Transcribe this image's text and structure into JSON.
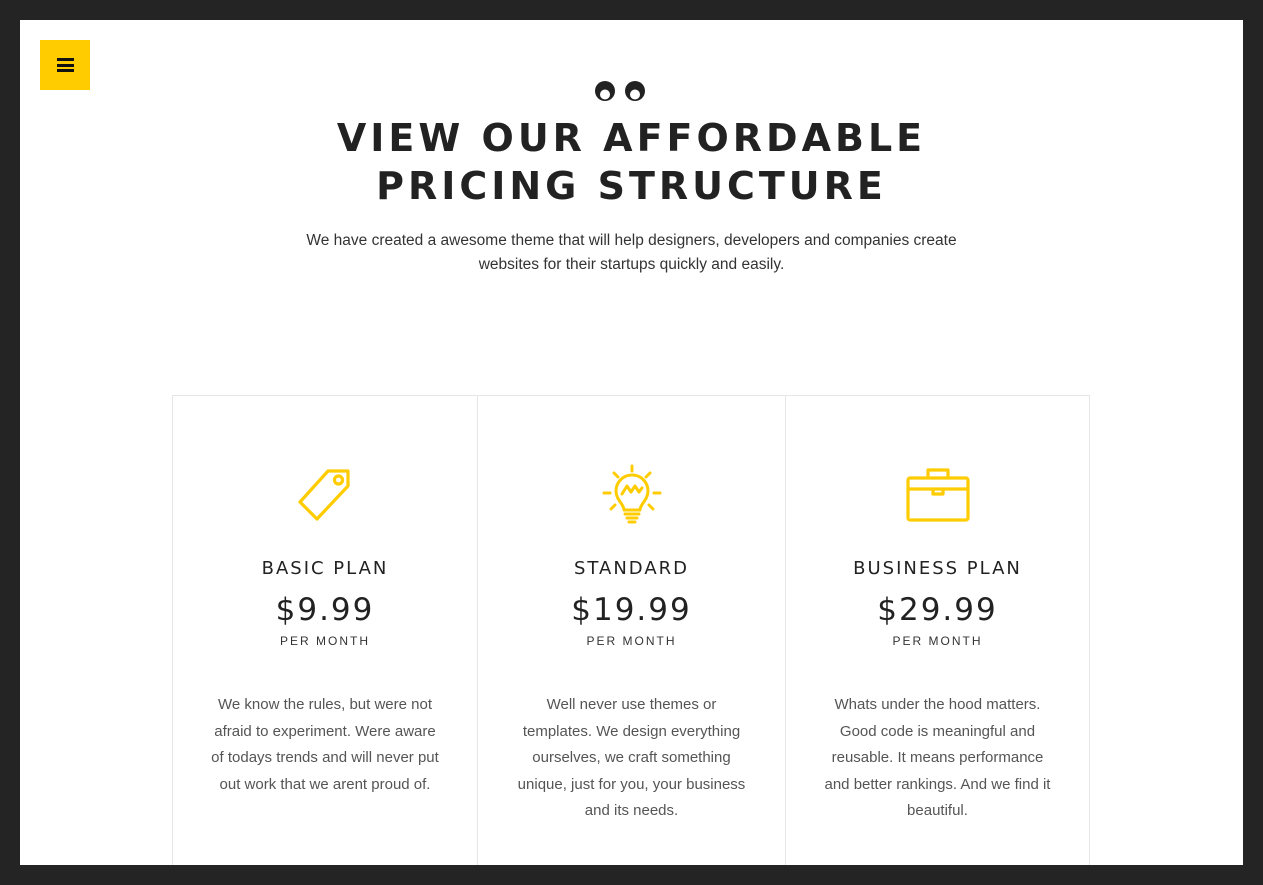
{
  "header": {
    "menu_icon": "hamburger-menu-icon",
    "eyes_icon": "eyes-icon",
    "title_line1": "VIEW OUR AFFORDABLE",
    "title_line2": "PRICING STRUCTURE",
    "subtitle_line1": "We have created a awesome theme that will help designers, developers and companies create",
    "subtitle_line2": "websites for their startups quickly and easily."
  },
  "plans": [
    {
      "icon": "price-tag-icon",
      "name": "BASIC PLAN",
      "price": "$9.99",
      "period": "PER MONTH",
      "description": "We know the rules, but were not afraid to experiment. Were aware of todays trends and will never put out work that we arent proud of."
    },
    {
      "icon": "lightbulb-icon",
      "name": "STANDARD",
      "price": "$19.99",
      "period": "PER MONTH",
      "description": "Well never use themes or templates. We design everything ourselves, we craft something unique, just for you, your business and its needs."
    },
    {
      "icon": "briefcase-icon",
      "name": "BUSINESS PLAN",
      "price": "$29.99",
      "period": "PER MONTH",
      "description": "Whats under the hood matters. Good code is meaningful and reusable. It means performance and better rankings. And we find it beautiful."
    }
  ],
  "colors": {
    "accent": "#ffcc00",
    "background": "#ffffff",
    "frame": "#242424",
    "text": "#222222"
  }
}
